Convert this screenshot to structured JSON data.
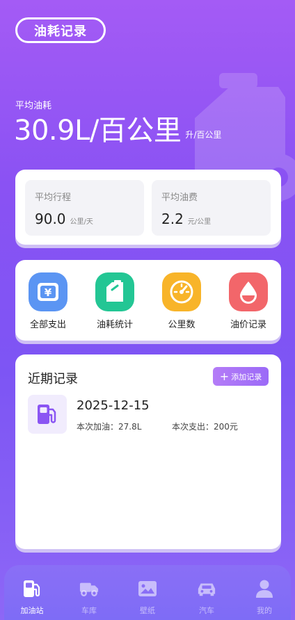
{
  "header": {
    "title": "油耗记录"
  },
  "summary": {
    "label": "平均油耗",
    "value": "30.9L/百公里",
    "unit": "升/百公里"
  },
  "stats": [
    {
      "label": "平均行程",
      "value": "90.0",
      "unit": "公里/天"
    },
    {
      "label": "平均油费",
      "value": "2.2",
      "unit": "元/公里"
    }
  ],
  "actions": [
    {
      "label": "全部支出",
      "icon": "yen-wallet-icon",
      "color": "#5b95f3"
    },
    {
      "label": "油耗统计",
      "icon": "fuel-can-icon",
      "color": "#23c694"
    },
    {
      "label": "公里数",
      "icon": "speedometer-icon",
      "color": "#f8b429"
    },
    {
      "label": "油价记录",
      "icon": "oil-drop-icon",
      "color": "#f2666a"
    }
  ],
  "recent": {
    "title": "近期记录",
    "add_label": "添加记录",
    "records": [
      {
        "date": "2025-12-15",
        "fill": "本次加油：27.8L",
        "spend": "本次支出：200元"
      }
    ]
  },
  "tabs": [
    {
      "label": "加油站",
      "icon": "gas-station-icon",
      "active": true
    },
    {
      "label": "车库",
      "icon": "truck-icon",
      "active": false
    },
    {
      "label": "壁纸",
      "icon": "picture-icon",
      "active": false
    },
    {
      "label": "汽车",
      "icon": "car-icon",
      "active": false
    },
    {
      "label": "我的",
      "icon": "user-icon",
      "active": false
    }
  ]
}
